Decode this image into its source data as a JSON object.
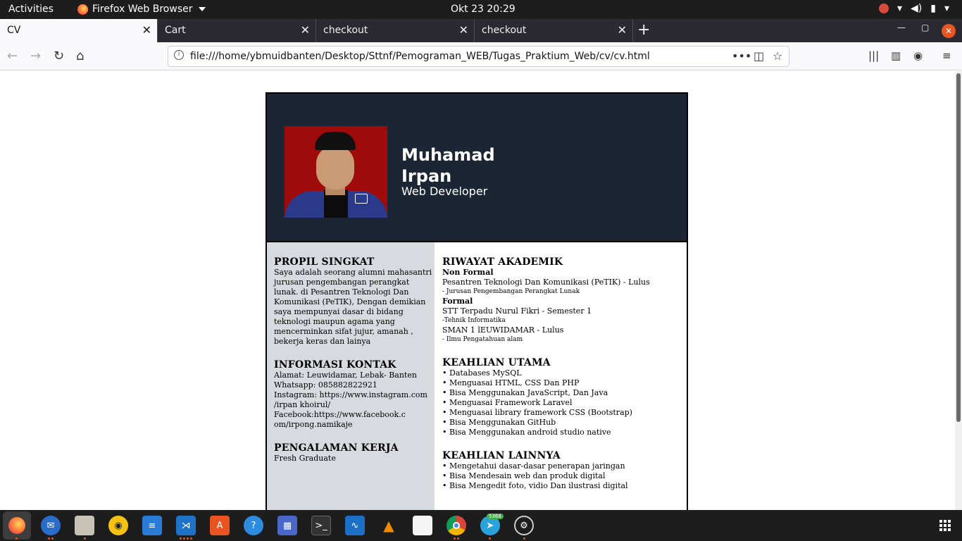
{
  "topbar": {
    "activities": "Activities",
    "app_menu": "Firefox Web Browser",
    "clock": "Okt 23  20:29"
  },
  "tabs": [
    {
      "label": "CV"
    },
    {
      "label": "Cart"
    },
    {
      "label": "checkout"
    },
    {
      "label": "checkout"
    }
  ],
  "navbar": {
    "url": "file:///home/ybmuidbanten/Desktop/Sttnf/Pemograman_WEB/Tugas_Praktium_Web/cv/cv.html"
  },
  "cv": {
    "name_line1": "Muhamad",
    "name_line2": "Irpan",
    "role": "Web Developer",
    "profile": {
      "heading": "PROPIL SINGKAT",
      "lines": [
        "Saya adalah seorang alumni mahasantri",
        "jurusan pengembangan perangkat",
        "lunak. di Pesantren Teknologi Dan",
        "Komunikasi (PeTIK), Dengan demikian",
        "saya mempunyai dasar di bidang",
        "teknologi maupun agama yang",
        "mencerminkan sifat jujur, amanah ,",
        "bekerja keras dan lainya"
      ]
    },
    "contact": {
      "heading": "INFORMASI KONTAK",
      "lines": [
        "Alamat: Leuwidamar, Lebak- Banten",
        "Whatsapp: 085882822921",
        "Instagram: https://www.instagram.com",
        "/irpan khoirul/",
        "Facebook:https://www.facebook.c",
        "om/irpong.namikaje"
      ]
    },
    "experience": {
      "heading": "PENGALAMAN KERJA",
      "text": "Fresh Graduate"
    },
    "academic": {
      "heading": "RIWAYAT AKADEMIK",
      "nonformal_label": "Non Formal",
      "nonformal_school": "Pesantren Teknologi Dan Komunikasi (PeTIK) - Lulus",
      "nonformal_major": "- Jurusan Pengembangan Perangkat Lunak",
      "formal_label": "Formal",
      "formal_school1": "STT Terpadu Nurul Fikri - Semester 1",
      "formal_major1": "-Tehnik Informatika",
      "formal_school2": "SMAN 1 lEUWIDAMAR - Lulus",
      "formal_major2": "- Ilmu Pengatahuan alam"
    },
    "main_skills": {
      "heading": "KEAHLIAN UTAMA",
      "items": [
        "Databases MySQL",
        "Menguasai HTML, CSS Dan PHP",
        "Bisa Menggunakan JavaScript, Dan Java",
        "Menguasai Framework Laravel",
        "Menguasai library framework CSS (Bootstrap)",
        "Bisa Menggunakan GitHub",
        "Bisa Menggunakan android studio native"
      ]
    },
    "other_skills": {
      "heading": "KEAHLIAN LAINNYA",
      "items": [
        "Mengetahui dasar-dasar penerapan jaringan",
        "Bisa Mendesain web dan produk digital",
        "Bisa Mengedit foto, vidio Dan ilustrasi digital"
      ]
    }
  },
  "taskbar": {
    "telegram_badge": "5368"
  },
  "colors": {
    "header_bg": "#1b2533",
    "left_col_bg": "#d7dbdf",
    "accent": "#e95420"
  }
}
